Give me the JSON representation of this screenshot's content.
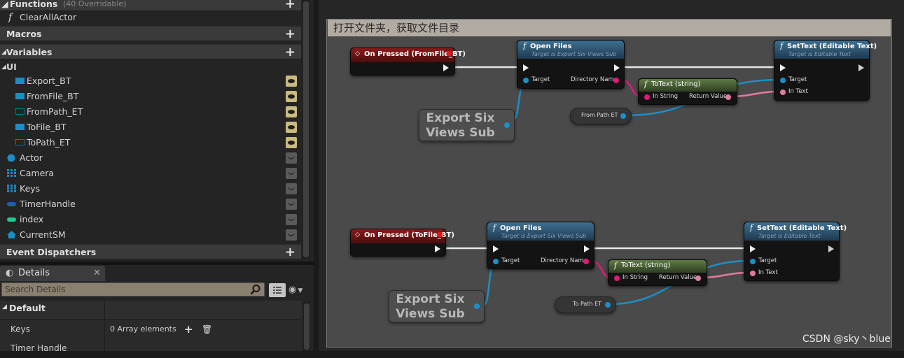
{
  "panel": {
    "functions": {
      "label": "Functions",
      "count": "(40 Overridable)"
    },
    "function_items": [
      "ClearAllActor"
    ],
    "macros_label": "Macros",
    "variables_label": "Variables",
    "ui_group": "UI",
    "ui_vars": [
      "Export_BT",
      "FromFile_BT",
      "FromPath_ET",
      "ToFile_BT",
      "ToPath_ET"
    ],
    "other_vars": [
      "Actor",
      "Camera",
      "Keys",
      "TimerHandle",
      "index",
      "CurrentSM"
    ],
    "event_dispatchers_label": "Event Dispatchers"
  },
  "details": {
    "tab_label": "Details",
    "search_placeholder": "Search Details",
    "default_label": "Default",
    "keys_label": "Keys",
    "keys_value": "0 Array elements",
    "timer_label": "Timer Handle"
  },
  "graph": {
    "comment": "打开文件夹，获取文件目录",
    "event1": "On Pressed (FromFile_BT)",
    "event2": "On Pressed (ToFile_BT)",
    "open_files": "Open Files",
    "open_files_sub": "Target is Export Six Views Sub",
    "settext": "SetText (Editable Text)",
    "settext_sub": "Target is Editable Text",
    "totext": "ToText (string)",
    "pin_target": "Target",
    "pin_dirname": "Directory Name",
    "pin_instring": "In String",
    "pin_retval": "Return Value",
    "pin_intext": "In Text",
    "self_ref": "Export Six Views Sub",
    "from_path": "From Path ET",
    "to_path": "To Path ET"
  },
  "watermark": "CSDN @sky丶blue",
  "colors": {
    "exec": "#f0f0f0",
    "object_pin": "#1c8fc7",
    "string_pin": "#e0197a",
    "text_pin": "#e27ba3"
  }
}
